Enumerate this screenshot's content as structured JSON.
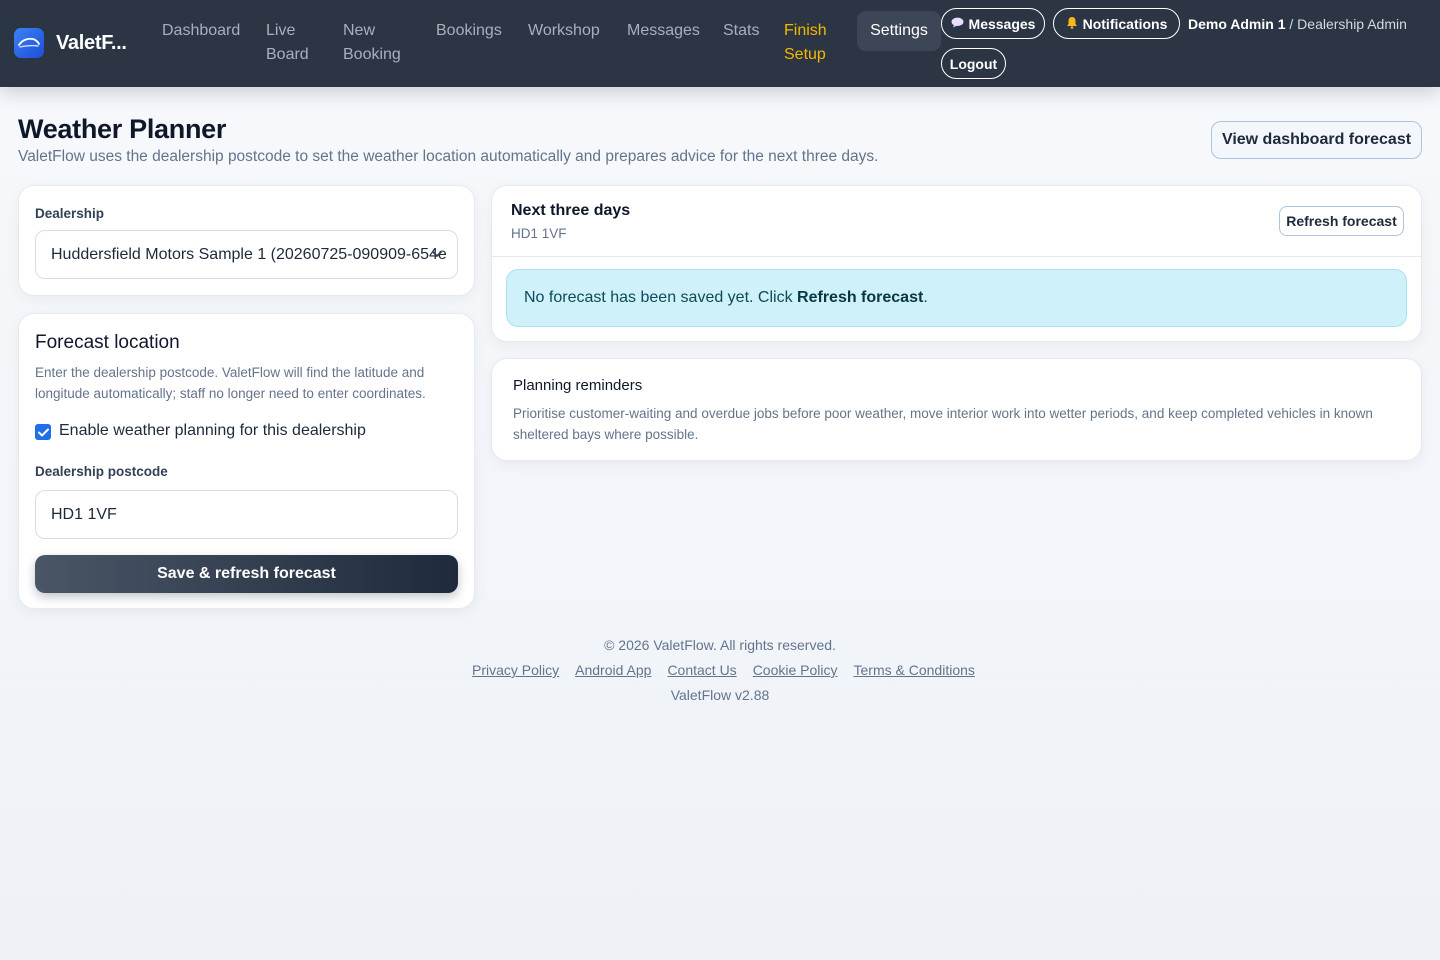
{
  "brand": {
    "name": "ValetF..."
  },
  "nav": {
    "dashboard": "Dashboard",
    "live_board_1": "Live",
    "live_board_2": "Board",
    "new_booking_1": "New",
    "new_booking_2": "Booking",
    "bookings": "Bookings",
    "workshop": "Workshop",
    "messages": "Messages",
    "stats": "Stats",
    "finish_setup_1": "Finish",
    "finish_setup_2": "Setup",
    "settings": "Settings",
    "messages_pill": "Messages",
    "notifications_pill": "Notifications",
    "logout": "Logout",
    "user_name": "Demo Admin 1",
    "user_sep": " / ",
    "user_role": "Dealership Admin"
  },
  "header": {
    "title": "Weather Planner",
    "subtitle": "ValetFlow uses the dealership postcode to set the weather location automatically and prepares advice for the next three days.",
    "dashboard_button": "View dashboard forecast"
  },
  "dealership_card": {
    "label": "Dealership",
    "selected": "Huddersfield Motors Sample 1 (20260725-090909-654e"
  },
  "location_card": {
    "title": "Forecast location",
    "help": "Enter the dealership postcode. ValetFlow will find the latitude and longitude automatically; staff no longer need to enter coordinates.",
    "enable_label": "Enable weather planning for this dealership",
    "enabled": true,
    "postcode_label": "Dealership postcode",
    "postcode_value": "HD1 1VF",
    "save_button": "Save & refresh forecast"
  },
  "forecast_card": {
    "title": "Next three days",
    "postcode": "HD1 1VF",
    "refresh_button": "Refresh forecast",
    "alert_text": "No forecast has been saved yet. Click ",
    "alert_link": "Refresh forecast",
    "alert_end": "."
  },
  "reminders_card": {
    "title": "Planning reminders",
    "text": "Prioritise customer-waiting and overdue jobs before poor weather, move interior work into wetter periods, and keep completed vehicles in known sheltered bays where possible."
  },
  "footer": {
    "copyright": "© 2026 ValetFlow. All rights reserved.",
    "links": [
      "Privacy Policy",
      "Android App",
      "Contact Us",
      "Cookie Policy",
      "Terms & Conditions"
    ],
    "version": "ValetFlow v2.88"
  },
  "colors": {
    "navbar": "#2b3544",
    "accent": "#1e6fe8",
    "finish_setup": "#f5b800",
    "alert_bg": "#cff1f9"
  }
}
